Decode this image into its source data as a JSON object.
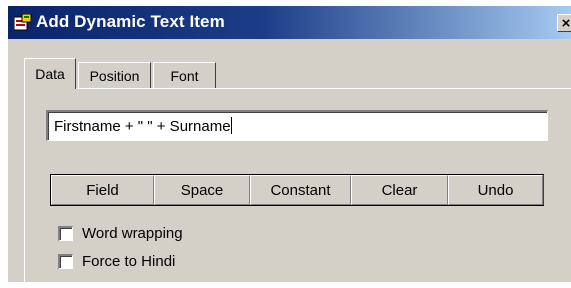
{
  "window": {
    "title": "Add Dynamic Text Item",
    "close_glyph": "×",
    "app_icon": "dialog-app-icon"
  },
  "tabs": [
    {
      "label": "Data",
      "active": true
    },
    {
      "label": "Position",
      "active": false
    },
    {
      "label": "Font",
      "active": false
    }
  ],
  "expression": {
    "value": "Firstname + \" \" + Surname"
  },
  "buttons": [
    {
      "label": "Field"
    },
    {
      "label": "Space"
    },
    {
      "label": "Constant"
    },
    {
      "label": "Clear"
    },
    {
      "label": "Undo"
    }
  ],
  "options": [
    {
      "label": "Word wrapping",
      "checked": false
    },
    {
      "label": "Force to Hindi",
      "checked": false
    }
  ],
  "colors": {
    "titlebar_start": "#0a246a",
    "titlebar_end": "#a6caf0",
    "face": "#d4d0c8"
  }
}
